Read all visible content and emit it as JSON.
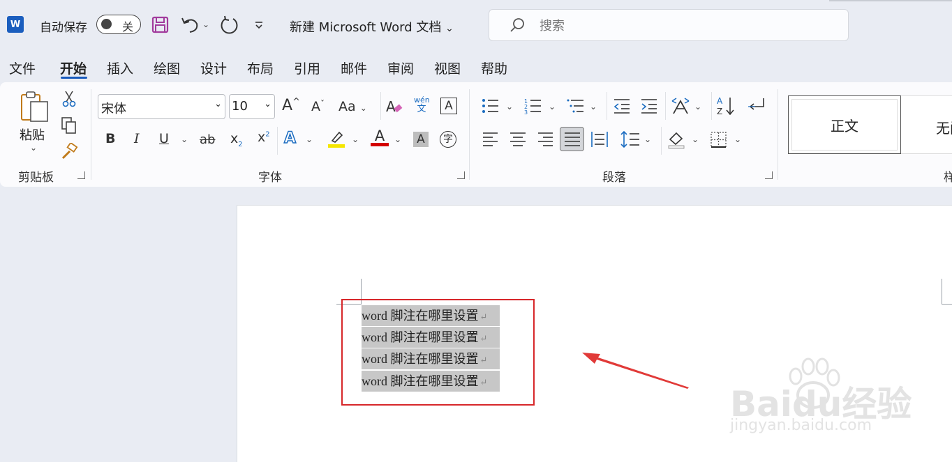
{
  "titlebar": {
    "app_icon_letter": "W",
    "autosave_label": "自动保存",
    "autosave_state": "关",
    "document_title": "新建 Microsoft Word 文档",
    "search_placeholder": "搜索"
  },
  "tabs": [
    {
      "label": "文件"
    },
    {
      "label": "开始",
      "active": true
    },
    {
      "label": "插入"
    },
    {
      "label": "绘图"
    },
    {
      "label": "设计"
    },
    {
      "label": "布局"
    },
    {
      "label": "引用"
    },
    {
      "label": "邮件"
    },
    {
      "label": "审阅"
    },
    {
      "label": "视图"
    },
    {
      "label": "帮助"
    }
  ],
  "ribbon": {
    "clipboard": {
      "paste_label": "粘贴",
      "group_label": "剪贴板"
    },
    "font": {
      "font_name": "宋体",
      "font_size": "10",
      "group_label": "字体",
      "change_case": "Aa",
      "phonetic_top": "wén",
      "phonetic_bottom": "文",
      "char_border": "A",
      "enclose_char": "字",
      "bold": "B",
      "italic": "I",
      "underline": "U",
      "strike": "ab",
      "subscript": "x",
      "superscript": "x",
      "text_effect": "A",
      "font_color": "A",
      "char_shading": "A"
    },
    "paragraph": {
      "group_label": "段落"
    },
    "styles": {
      "style1": "正文",
      "style2": "无间",
      "group_label": "样式"
    }
  },
  "document": {
    "lines": [
      "word 脚注在哪里设置",
      "word 脚注在哪里设置",
      "word 脚注在哪里设置",
      "word 脚注在哪里设置"
    ]
  },
  "watermark": {
    "brand": "Baidu经验",
    "url": "jingyan.baidu.com"
  },
  "colors": {
    "accent": "#185abd",
    "annotation": "#d7272a",
    "highlight": "#c7c7c7"
  }
}
